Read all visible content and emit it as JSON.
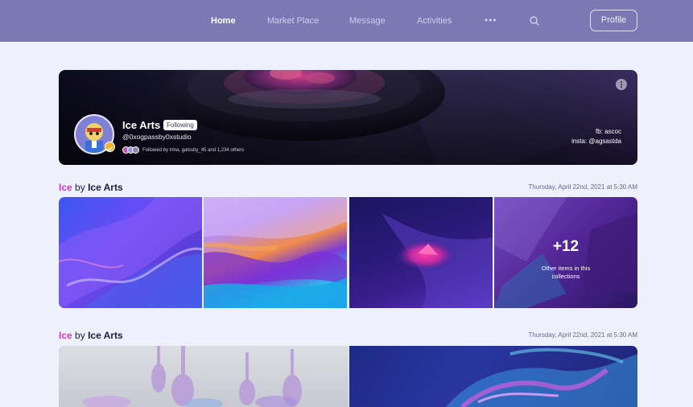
{
  "nav": {
    "items": [
      "Home",
      "Market Place",
      "Message",
      "Activities"
    ],
    "active": "Home",
    "more_label": "•••",
    "profile_label": "Profile"
  },
  "profile": {
    "name": "Ice Arts",
    "following_label": "Following",
    "handle": "@0xogpassby0xstudio",
    "followed_by": "Followed by trina, gatssby_45 and 1,234 others",
    "fb": "fb: ascoc",
    "insta": "insta: @agsastda"
  },
  "collections": [
    {
      "title_accent": "Ice",
      "title_by": "by",
      "title_owner": "Ice Arts",
      "date": "Thursday, April 22nd, 2021 at 5:30 AM",
      "more_count": "+12",
      "more_text": "Other items in this collections"
    },
    {
      "title_accent": "Ice",
      "title_by": "by",
      "title_owner": "Ice Arts",
      "date": "Thursday, April 22nd, 2021 at 5:30 AM"
    }
  ],
  "colors": {
    "nav_bg": "#7b78b3",
    "page_bg": "#eef0fb",
    "accent_pink": "#d936c9",
    "text_dark": "#1f1d3d"
  }
}
